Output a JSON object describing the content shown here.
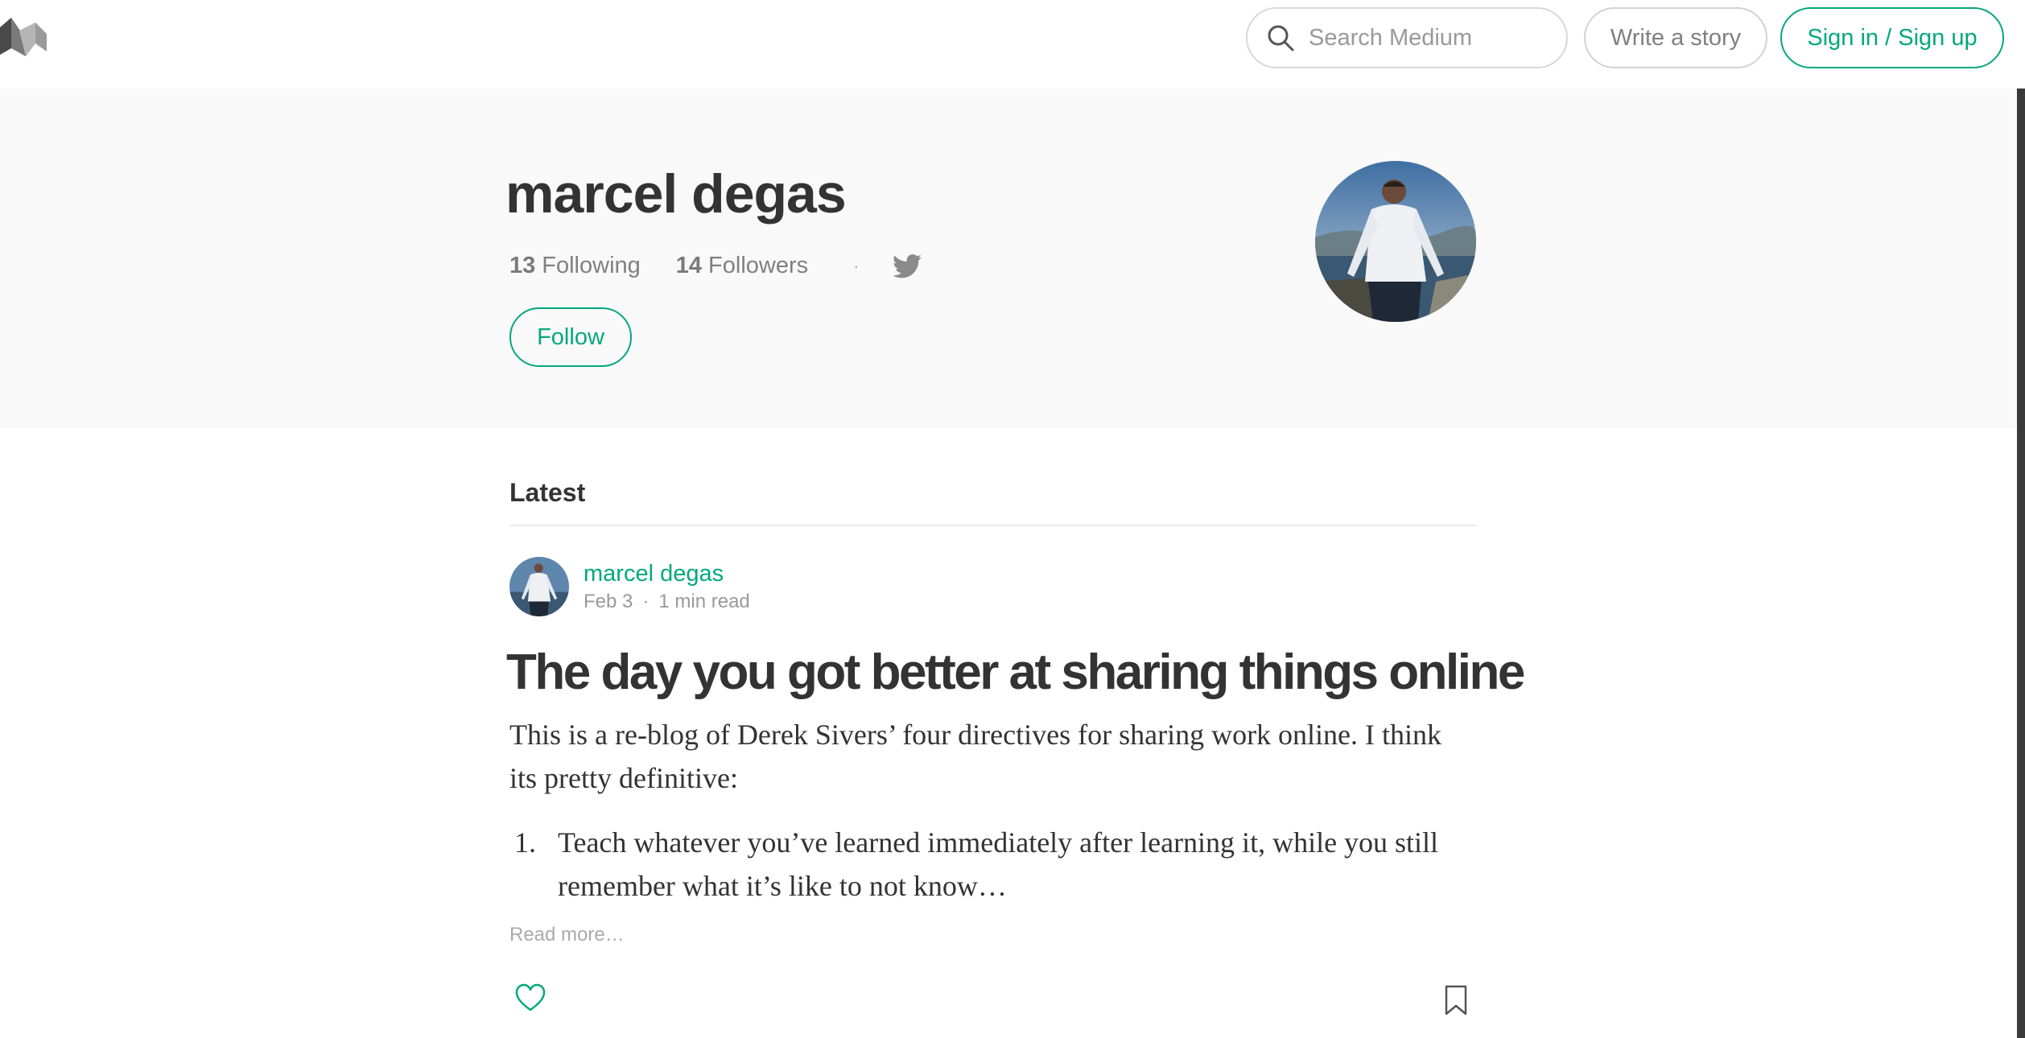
{
  "header": {
    "logo": "medium-logo",
    "search": {
      "placeholder": "Search Medium",
      "value": ""
    },
    "write_label": "Write a story",
    "signin_label": "Sign in / Sign up"
  },
  "profile": {
    "name": "marcel degas",
    "following_count": "13",
    "following_label": "Following",
    "followers_count": "14",
    "followers_label": "Followers",
    "separator": "·",
    "social_icon": "twitter-icon",
    "follow_label": "Follow"
  },
  "latest": {
    "title": "Latest",
    "post": {
      "author": "marcel degas",
      "date": "Feb 3",
      "meta_sep": "·",
      "read_time": "1 min read",
      "title": "The day you got better at sharing things online",
      "body": "This is a re-blog of Derek Sivers’ four directives for sharing work online. I think its pretty definitive:",
      "list": [
        {
          "num": "1.",
          "text": "Teach whatever you’ve learned immediately after learning it, while you still remember what it’s like to not know…"
        }
      ],
      "read_more": "Read more…",
      "actions": {
        "clap_icon": "heart-icon",
        "bookmark_icon": "bookmark-icon"
      }
    }
  },
  "colors": {
    "accent": "#03a87c",
    "text": "#333333",
    "muted": "#999999",
    "hero_bg": "#f9f9f9"
  }
}
